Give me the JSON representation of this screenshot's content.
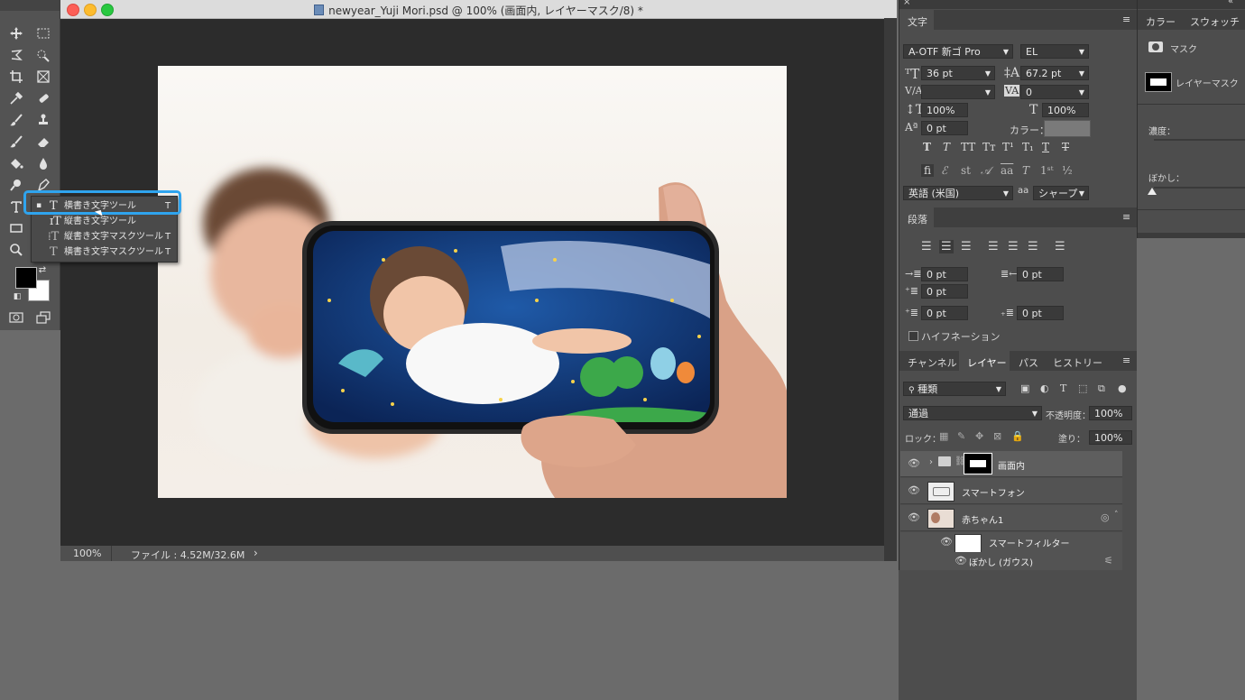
{
  "document": {
    "title": "newyear_Yuji Mori.psd @ 100% (画面内, レイヤーマスク/8) *",
    "zoom": "100%",
    "file_info": "ファイル : 4.52M/32.6M",
    "status_arrow": "›"
  },
  "tool_flyout": {
    "items": [
      {
        "label": "横書き文字ツール",
        "shortcut": "T",
        "selected": true
      },
      {
        "label": "縦書き文字ツール",
        "shortcut": ""
      },
      {
        "label": "縦書き文字マスクツール",
        "shortcut": "T"
      },
      {
        "label": "横書き文字マスクツール",
        "shortcut": "T"
      }
    ]
  },
  "character_panel": {
    "title": "文字",
    "font_family": "A-OTF 新ゴ Pro",
    "font_style": "EL",
    "font_size": "36 pt",
    "leading": "67.2 pt",
    "kerning": "",
    "tracking": "0",
    "vertical_scale": "100%",
    "horizontal_scale": "100%",
    "baseline_shift": "0 pt",
    "color_label": "カラー：",
    "language": "英語 (米国)",
    "aa_icon": "aa",
    "anti_alias": "シャープ"
  },
  "paragraph_panel": {
    "title": "段落",
    "indent_left": "0 pt",
    "indent_right": "0 pt",
    "indent_first": "0 pt",
    "space_before": "0 pt",
    "space_after": "0 pt",
    "hyphenation_label": "ハイフネーション"
  },
  "layers_panel": {
    "tabs": [
      "チャンネル",
      "レイヤー",
      "パス",
      "ヒストリー"
    ],
    "active_tab": "レイヤー",
    "filter_label": "種類",
    "blend_mode": "通過",
    "opacity_label": "不透明度：",
    "opacity": "100%",
    "lock_label": "ロック：",
    "fill_label": "塗り：",
    "fill": "100%",
    "layers": [
      {
        "name": "画面内"
      },
      {
        "name": "スマートフォン"
      },
      {
        "name": "赤ちゃん1"
      },
      {
        "name": "スマートフィルター"
      },
      {
        "name": "ぼかし (ガウス)"
      }
    ]
  },
  "properties_panel": {
    "tabs": [
      "カラー",
      "スウォッチ"
    ],
    "mask_label": "マスク",
    "layer_mask_label": "レイヤーマスク",
    "density_label": "濃度：",
    "feather_label": "ぼかし："
  },
  "colors": {
    "accent_highlight": "#2fa4ee",
    "panel_bg": "#4d4d4d",
    "doc_bg": "#2c2c2c"
  }
}
